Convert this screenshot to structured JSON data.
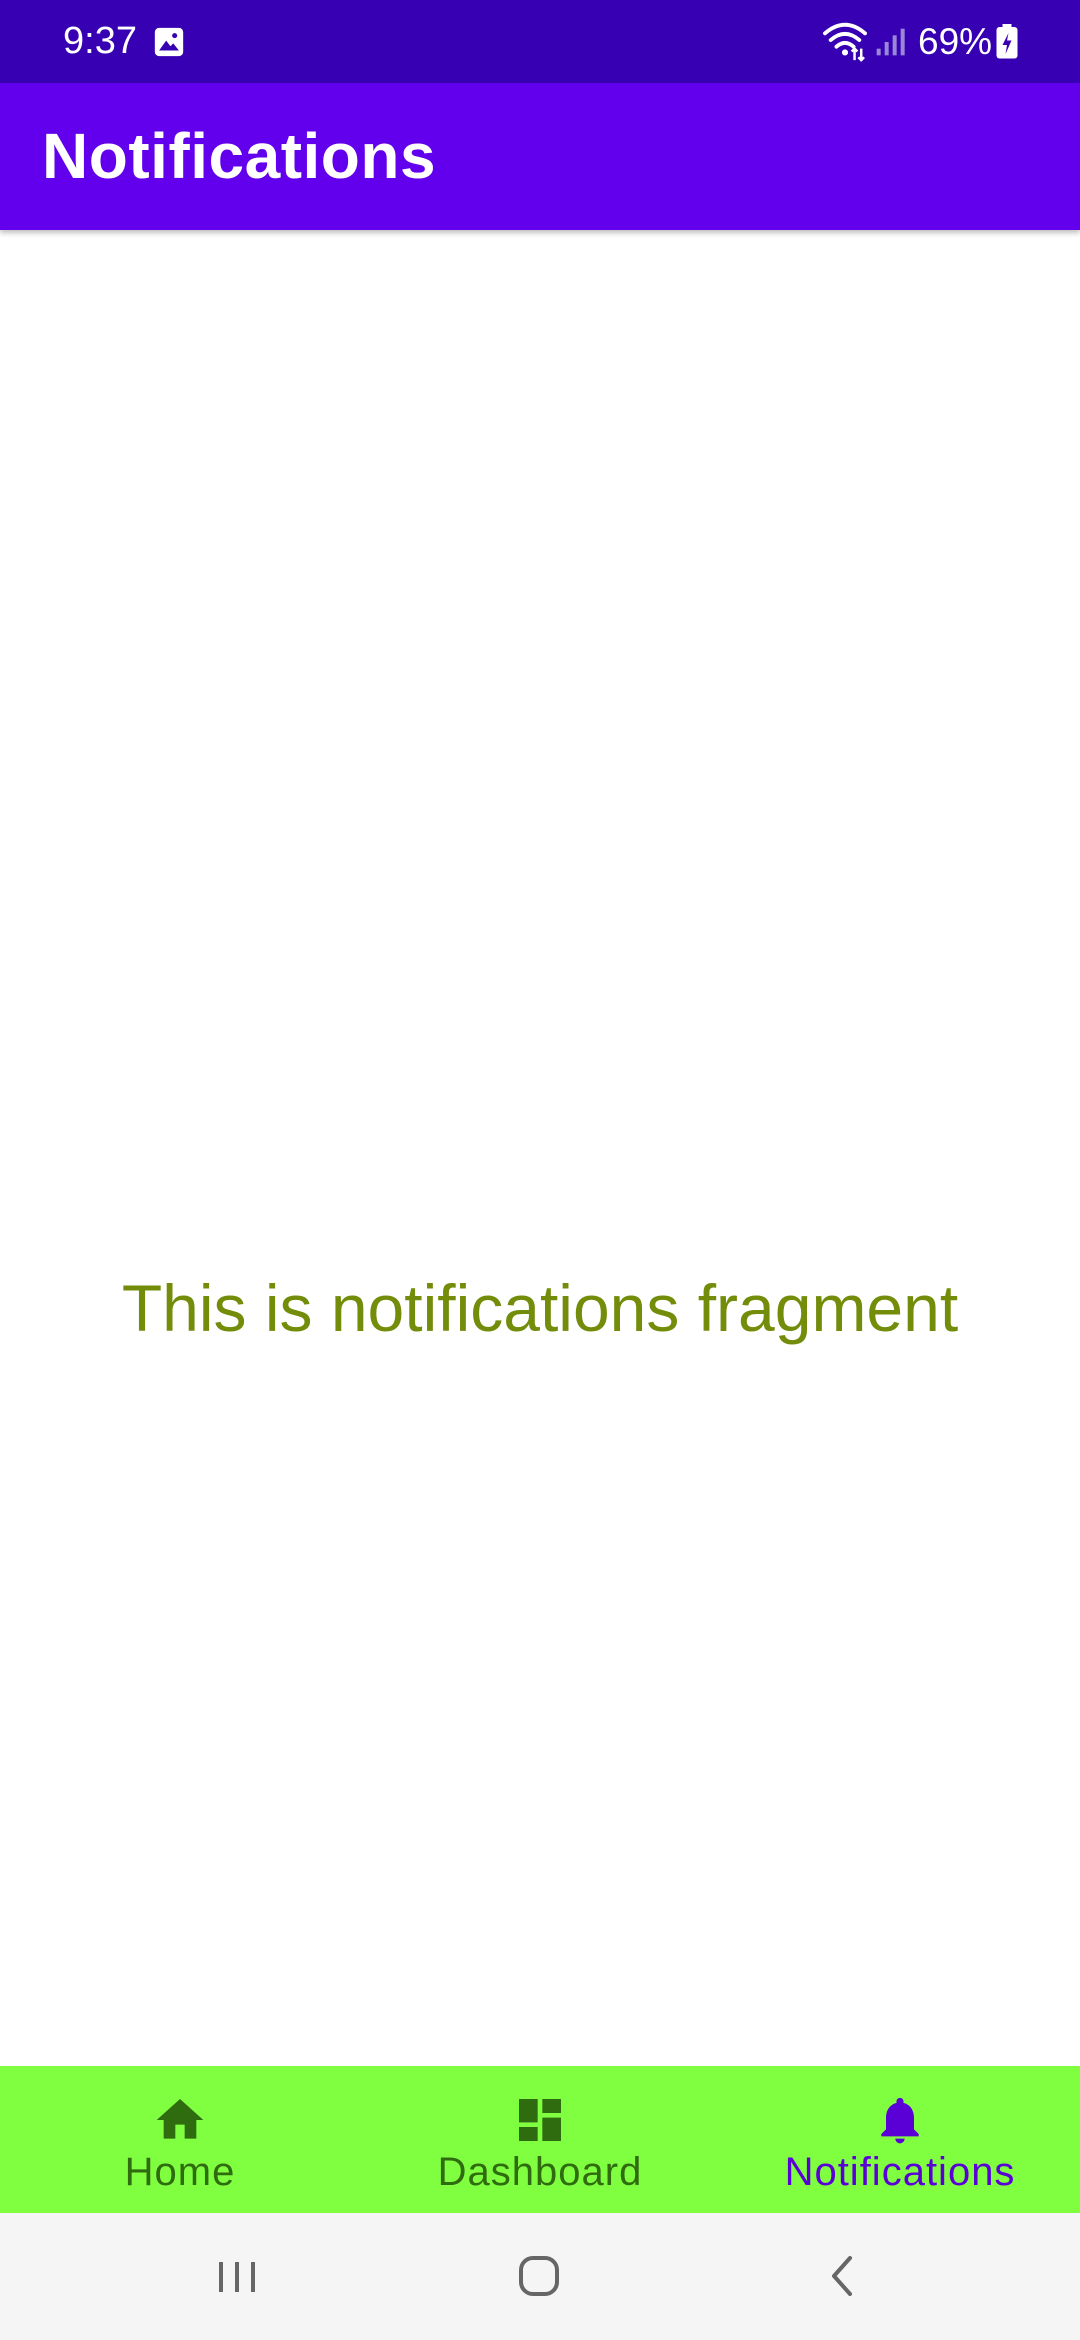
{
  "status_bar": {
    "time": "9:37",
    "battery": "69%",
    "icons": [
      "gallery-icon",
      "wifi-icon",
      "signal-icon",
      "battery-icon"
    ]
  },
  "app_bar": {
    "title": "Notifications"
  },
  "content": {
    "message": "This is notifications fragment"
  },
  "bottom_nav": {
    "items": [
      {
        "label": "Home",
        "icon": "home-icon",
        "active": false
      },
      {
        "label": "Dashboard",
        "icon": "dashboard-icon",
        "active": false
      },
      {
        "label": "Notifications",
        "icon": "bell-icon",
        "active": true
      }
    ]
  },
  "system_nav": {
    "buttons": [
      "recents-icon",
      "home-circle-icon",
      "back-icon"
    ]
  },
  "colors": {
    "status_bar": "#3700b3",
    "app_bar": "#6200ee",
    "content_text": "#738c0a",
    "bottom_nav_bg": "#80ff40",
    "nav_inactive": "#2f6b0f",
    "nav_active": "#5a00d6",
    "system_nav_bg": "#f5f5f5"
  }
}
